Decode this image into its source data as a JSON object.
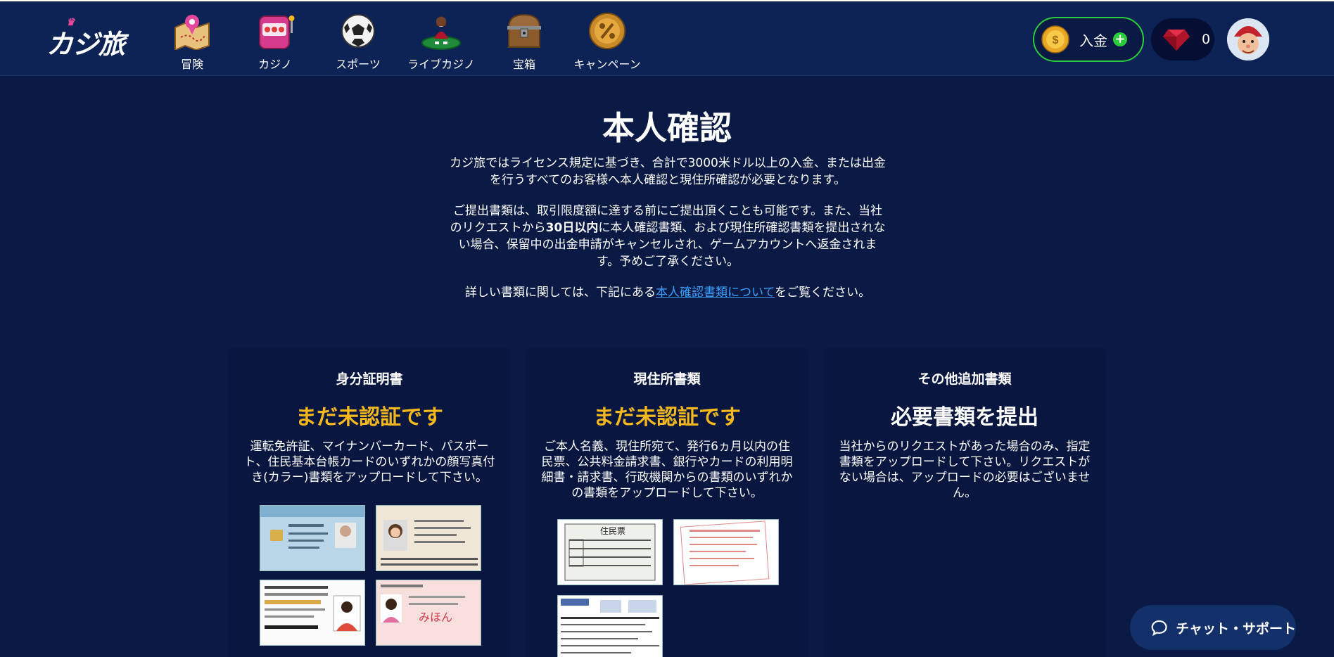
{
  "header": {
    "logo_text": "カジ旅",
    "nav": [
      {
        "label": "冒険",
        "icon": "map-icon"
      },
      {
        "label": "カジノ",
        "icon": "slot-machine-icon"
      },
      {
        "label": "スポーツ",
        "icon": "soccer-ball-icon"
      },
      {
        "label": "ライブカジノ",
        "icon": "live-dealer-icon"
      },
      {
        "label": "宝箱",
        "icon": "treasure-chest-icon"
      },
      {
        "label": "キャンペーン",
        "icon": "percent-badge-icon"
      }
    ],
    "deposit_label": "入金",
    "gem_count": "0"
  },
  "main": {
    "title": "本人確認",
    "intro_p1": "カジ旅ではライセンス規定に基づき、合計で3000米ドル以上の入金、または出金を行うすべてのお客様へ本人確認と現住所確認が必要となります。",
    "intro_p2_a": "ご提出書類は、取引限度額に達する前にご提出頂くことも可能です。また、当社のリクエストから",
    "intro_p2_bold": "30日以内",
    "intro_p2_b": "に本人確認書類、および現住所確認書類を提出されない場合、保留中の出金申請がキャンセルされ、ゲームアカウントへ返金されます。予めご了承ください。",
    "intro_p3_a": "詳しい書類に関しては、下記にある",
    "intro_p3_link": "本人確認書類について",
    "intro_p3_b": "をご覧ください。"
  },
  "cards": [
    {
      "title": "身分証明書",
      "status": "まだ未認証です",
      "desc": "運転免許証、マイナンバーカード、パスポート、住民基本台帳カードのいずれかの顔写真付き(カラー)書類をアップロードして下さい。",
      "thumbs": [
        "住民基本台帳カード",
        "パスポート",
        "運転免許証",
        "マイナンバーカード"
      ]
    },
    {
      "title": "現住所書類",
      "status": "まだ未認証です",
      "desc": "ご本人名義、現住所宛て、発行6ヵ月以内の住民票、公共料金請求書、銀行やカードの利用明細書・請求書、行政機関からの書類のいずれかの書類をアップロードして下さい。",
      "thumbs": [
        "住民票",
        "公共料金請求書",
        "利用明細書"
      ]
    },
    {
      "title": "その他追加書類",
      "status": "必要書類を提出",
      "desc": "当社からのリクエストがあった場合のみ、指定書類をアップロードして下さい。リクエストがない場合は、アップロードの必要はございません。"
    }
  ],
  "chat": {
    "label": "チャット・サポート"
  },
  "colors": {
    "background": "#0a1a44",
    "header": "#0d2255",
    "card": "#081640",
    "status_pending": "#f5b91e",
    "deposit_border": "#2ccd3d",
    "link": "#3aa0ff"
  }
}
